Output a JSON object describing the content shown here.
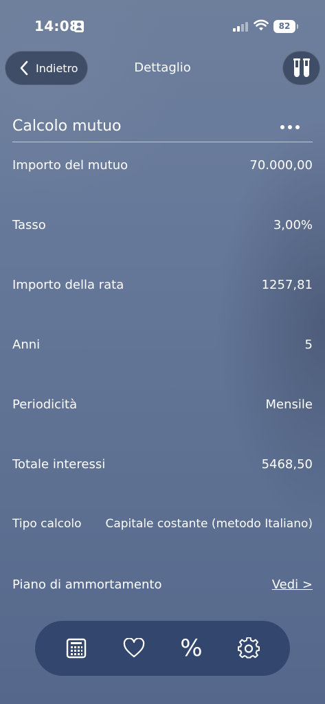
{
  "status_bar": {
    "time": "14:08",
    "battery": "82",
    "icons": [
      "id-card-icon",
      "signal-icon",
      "wifi-icon",
      "battery-icon"
    ]
  },
  "nav": {
    "back_label": "Indietro",
    "title": "Dettaglio",
    "right_icon": "test-tubes-icon"
  },
  "section": {
    "title": "Calcolo mutuo",
    "more_icon": "ellipsis-icon"
  },
  "rows": [
    {
      "label": "Importo del mutuo",
      "value": "70.000,00"
    },
    {
      "label": "Tasso",
      "value": "3,00%"
    },
    {
      "label": "Importo della rata",
      "value": "1257,81"
    },
    {
      "label": "Anni",
      "value": "5"
    },
    {
      "label": "Periodicità",
      "value": "Mensile"
    },
    {
      "label": "Totale interessi",
      "value": "5468,50"
    },
    {
      "label": "Tipo calcolo",
      "value": "Capitale costante (metodo Italiano)"
    },
    {
      "label": "Piano di ammortamento",
      "value": "Vedi >"
    }
  ],
  "tab_bar": {
    "items": [
      "calculator-icon",
      "heart-icon",
      "percent-icon",
      "gear-icon"
    ],
    "percent_glyph": "%"
  },
  "colors": {
    "background": "#66789a",
    "button_bg": "#3f4d66",
    "tab_bar_bg": "#33466d",
    "text": "#ffffff"
  }
}
